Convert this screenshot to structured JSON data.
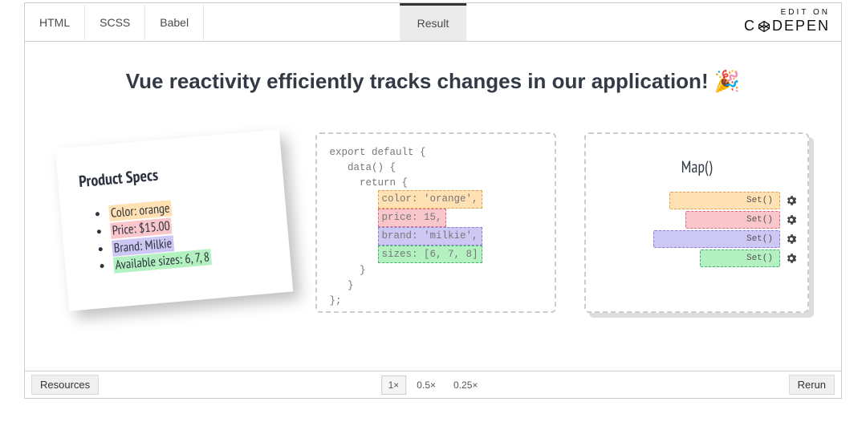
{
  "topbar": {
    "tabs": [
      "HTML",
      "SCSS",
      "Babel"
    ],
    "result_tab": "Result",
    "edit_on": "EDIT ON",
    "brand_left": "C",
    "brand_right": "DEPEN"
  },
  "heading": "Vue reactivity efficiently tracks changes in our application! 🎉",
  "product": {
    "title": "Product Specs",
    "items": [
      {
        "label": "Color: orange",
        "cls": "hl-orange"
      },
      {
        "label": "Price: $15.00",
        "cls": "hl-pink"
      },
      {
        "label": "Brand: Milkie",
        "cls": "hl-purple"
      },
      {
        "label": "Available sizes: 6, 7, 8",
        "cls": "hl-green"
      }
    ]
  },
  "code": {
    "l1": "export default {",
    "l2": "   data() {",
    "l3": "     return {",
    "c1": "color: 'orange',",
    "c2": "price: 15,",
    "c3": "brand: 'milkie',",
    "c4": "sizes: [6, 7, 8]",
    "l4": "     }",
    "l5": "   }",
    "l6": "};"
  },
  "map": {
    "title": "Map()",
    "set_label": "Set()"
  },
  "bottombar": {
    "resources": "Resources",
    "zoom": [
      "1×",
      "0.5×",
      "0.25×"
    ],
    "rerun": "Rerun"
  }
}
